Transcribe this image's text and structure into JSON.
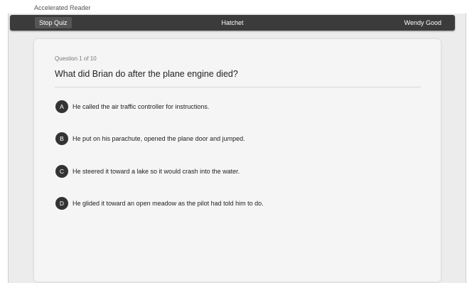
{
  "app": {
    "title": "Accelerated Reader"
  },
  "toolbar": {
    "stop_label": "Stop Quiz",
    "quiz_title": "Hatchet",
    "user_name": "Wendy Good"
  },
  "question": {
    "counter": "Question 1 of 10",
    "text": "What did Brian do after the plane engine died?",
    "answers": [
      {
        "letter": "A",
        "text": "He called the air traffic controller for instructions."
      },
      {
        "letter": "B",
        "text": "He put on his parachute, opened the plane door and jumped."
      },
      {
        "letter": "C",
        "text": "He steered it toward a lake so it would crash into the water."
      },
      {
        "letter": "D",
        "text": "He glided it toward an open meadow as the pilot had told him to do."
      }
    ]
  }
}
